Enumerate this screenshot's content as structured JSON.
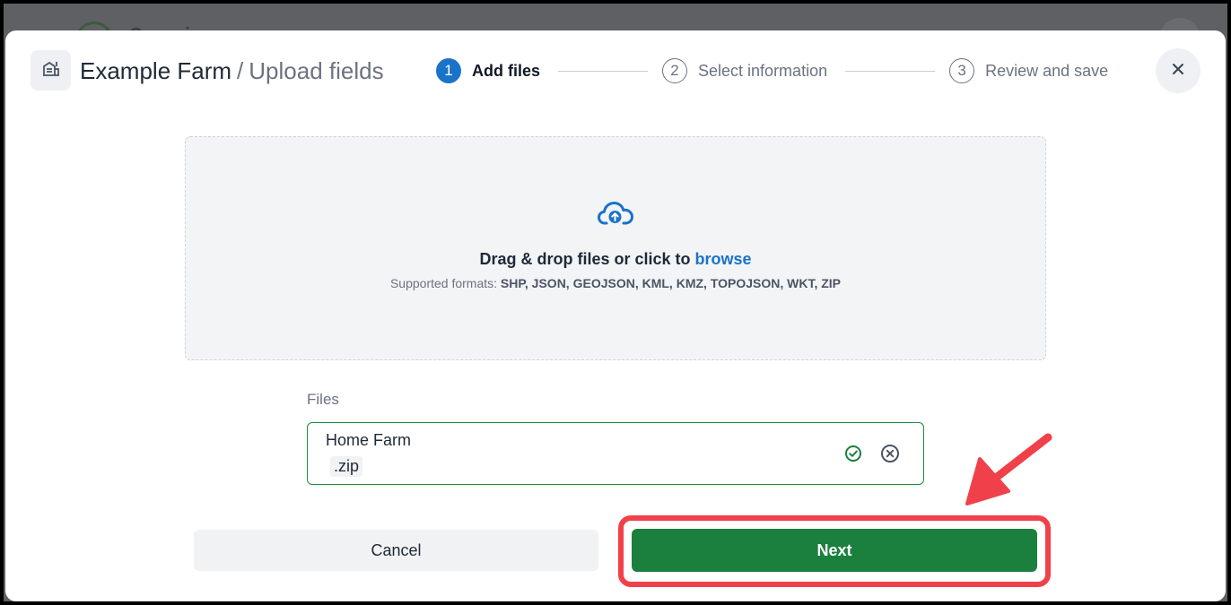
{
  "backdrop": {
    "brand": "Cropwise"
  },
  "header": {
    "farm_name": "Example Farm",
    "separator": "/",
    "page_title": "Upload fields",
    "icon": "farm-building-icon"
  },
  "stepper": {
    "steps": [
      {
        "number": "1",
        "label": "Add files",
        "active": true
      },
      {
        "number": "2",
        "label": "Select information",
        "active": false
      },
      {
        "number": "3",
        "label": "Review and save",
        "active": false
      }
    ]
  },
  "close": {
    "icon": "close-icon"
  },
  "dropzone": {
    "icon": "cloud-upload-icon",
    "text": "Drag & drop files or click to ",
    "browse_label": "browse",
    "formats_prefix": "Supported formats: ",
    "formats_list": "SHP, JSON, GEOJSON, KML, KMZ, TOPOJSON, WKT, ZIP"
  },
  "files": {
    "label": "Files",
    "items": [
      {
        "name": "Home Farm",
        "extension": ".zip",
        "status_icon": "check-circle-icon",
        "remove_icon": "remove-circle-icon"
      }
    ]
  },
  "actions": {
    "cancel_label": "Cancel",
    "next_label": "Next"
  },
  "colors": {
    "primary_blue": "#1a73c9",
    "success_green": "#1b7f3e",
    "annotation_red": "#f0414a"
  }
}
